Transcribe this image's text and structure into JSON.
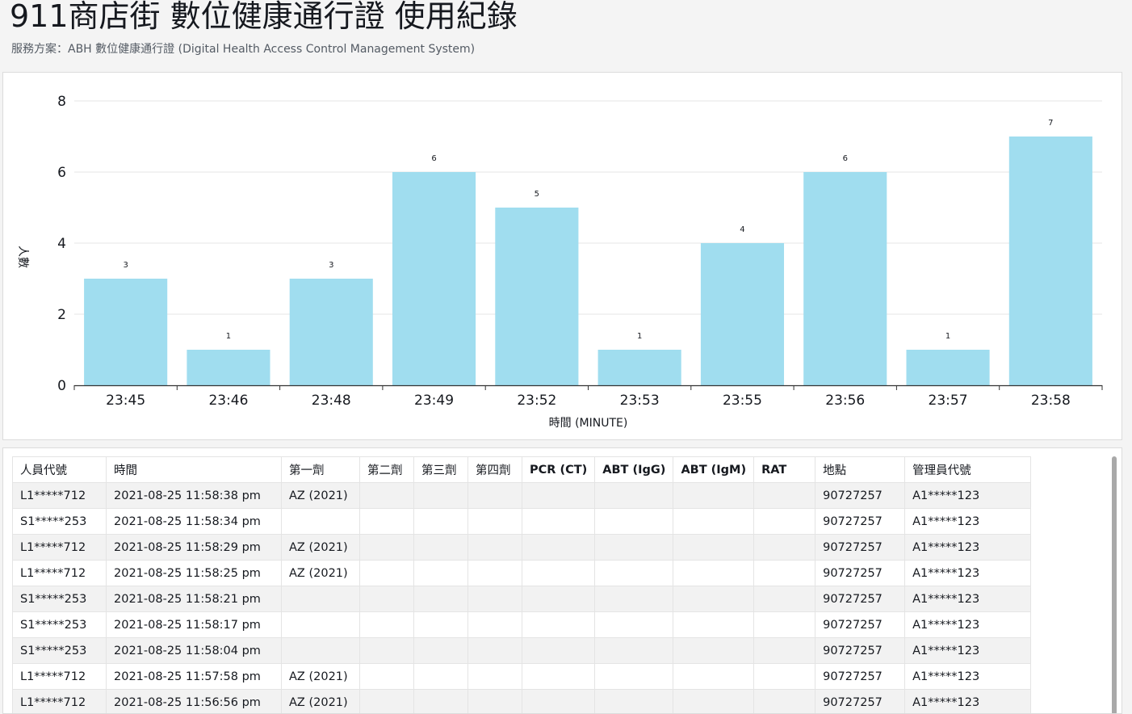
{
  "header": {
    "title": "911商店街 數位健康通行證 使用紀錄",
    "subtitle": "服務方案：ABH 數位健康通行證 (Digital Health Access Control Management System)"
  },
  "chart_data": {
    "type": "bar",
    "categories": [
      "23:45",
      "23:46",
      "23:48",
      "23:49",
      "23:52",
      "23:53",
      "23:55",
      "23:56",
      "23:57",
      "23:58"
    ],
    "values": [
      3,
      1,
      3,
      6,
      5,
      1,
      4,
      6,
      1,
      7
    ],
    "xlabel": "時間 (MINUTE)",
    "ylabel": "人數",
    "ylim": [
      0,
      8
    ],
    "yticks": [
      0,
      2,
      4,
      6,
      8
    ],
    "grid": true,
    "bar_color": "#a0ddef"
  },
  "table": {
    "columns": [
      "人員代號",
      "時間",
      "第一劑",
      "第二劑",
      "第三劑",
      "第四劑",
      "PCR (CT)",
      "ABT (IgG)",
      "ABT (IgM)",
      "RAT",
      "地點",
      "管理員代號"
    ],
    "rows": [
      [
        "L1*****712",
        "2021-08-25 11:58:38 pm",
        "AZ (2021)",
        "",
        "",
        "",
        "",
        "",
        "",
        "",
        "90727257",
        "A1*****123"
      ],
      [
        "S1*****253",
        "2021-08-25 11:58:34 pm",
        "",
        "",
        "",
        "",
        "",
        "",
        "",
        "",
        "90727257",
        "A1*****123"
      ],
      [
        "L1*****712",
        "2021-08-25 11:58:29 pm",
        "AZ (2021)",
        "",
        "",
        "",
        "",
        "",
        "",
        "",
        "90727257",
        "A1*****123"
      ],
      [
        "L1*****712",
        "2021-08-25 11:58:25 pm",
        "AZ (2021)",
        "",
        "",
        "",
        "",
        "",
        "",
        "",
        "90727257",
        "A1*****123"
      ],
      [
        "S1*****253",
        "2021-08-25 11:58:21 pm",
        "",
        "",
        "",
        "",
        "",
        "",
        "",
        "",
        "90727257",
        "A1*****123"
      ],
      [
        "S1*****253",
        "2021-08-25 11:58:17 pm",
        "",
        "",
        "",
        "",
        "",
        "",
        "",
        "",
        "90727257",
        "A1*****123"
      ],
      [
        "S1*****253",
        "2021-08-25 11:58:04 pm",
        "",
        "",
        "",
        "",
        "",
        "",
        "",
        "",
        "90727257",
        "A1*****123"
      ],
      [
        "L1*****712",
        "2021-08-25 11:57:58 pm",
        "AZ (2021)",
        "",
        "",
        "",
        "",
        "",
        "",
        "",
        "90727257",
        "A1*****123"
      ],
      [
        "L1*****712",
        "2021-08-25 11:56:56 pm",
        "AZ (2021)",
        "",
        "",
        "",
        "",
        "",
        "",
        "",
        "90727257",
        "A1*****123"
      ]
    ]
  }
}
